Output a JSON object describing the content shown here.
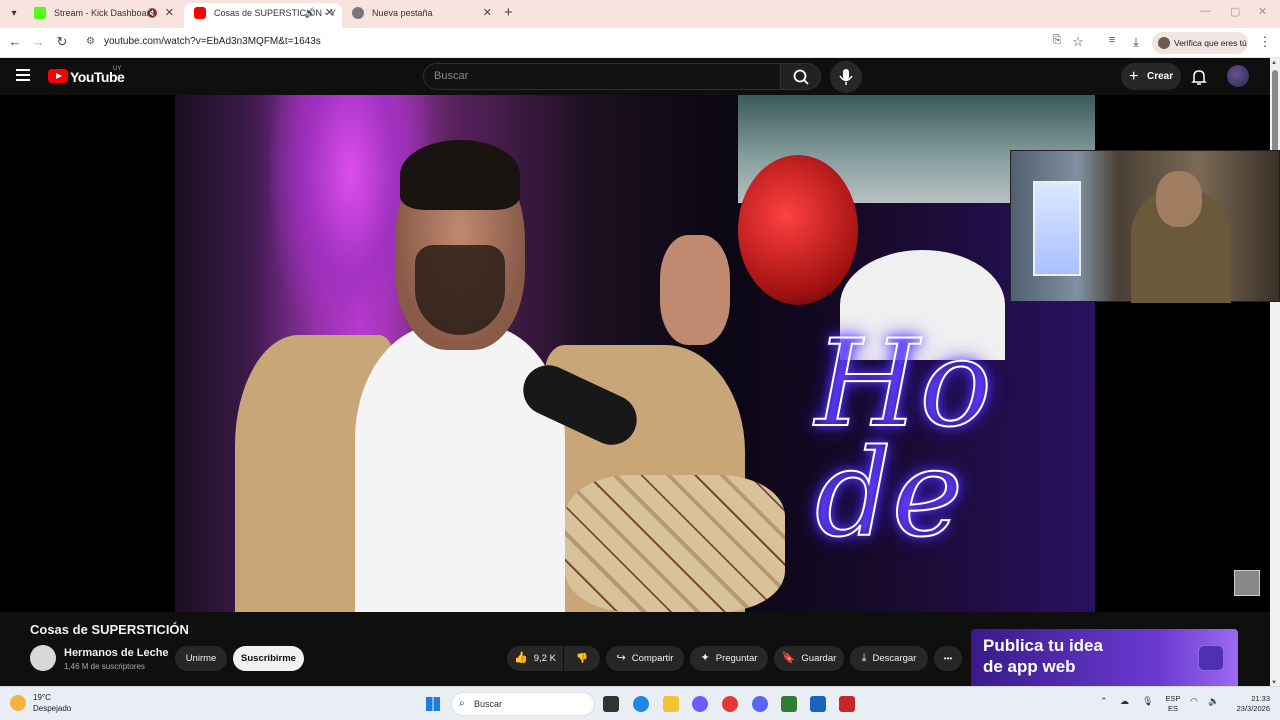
{
  "browser": {
    "tabs": [
      {
        "title": "Stream - Kick Dashboard",
        "muted": true
      },
      {
        "title": "Cosas de SUPERSTICIÓN - Y",
        "active": true,
        "audio": true
      },
      {
        "title": "Nueva pestaña"
      }
    ],
    "new_tab": "+",
    "url": "youtube.com/watch?v=EbAd3n3MQFM&t=1643s",
    "verify_label": "Verifica que eres tú"
  },
  "youtube": {
    "logo_text": "YouTube",
    "country": "UY",
    "search_placeholder": "Buscar",
    "create_label": "Crear"
  },
  "video": {
    "title": "Cosas de SUPERSTICIÓN",
    "channel": "Hermanos de Leche",
    "subscribers": "1,46 M de suscriptores",
    "join_label": "Unirme",
    "subscribe_label": "Suscribirme",
    "likes": "9,2 K",
    "share_label": "Compartir",
    "ask_label": "Preguntar",
    "save_label": "Guardar",
    "download_label": "Descargar",
    "more_label": "•••"
  },
  "ad": {
    "line1": "Publica tu idea",
    "line2": "de app web"
  },
  "taskbar": {
    "temp": "19°C",
    "condition": "Despejado",
    "search": "Buscar",
    "lang1": "ESP",
    "lang2": "ES",
    "time": "21:33",
    "date": "23/3/2026"
  },
  "colors": {
    "yt_bg": "#0f0f0f",
    "yt_red": "#ff0000",
    "tab_strip": "#f8e3df",
    "ad_purple": "#6a3ad0"
  }
}
